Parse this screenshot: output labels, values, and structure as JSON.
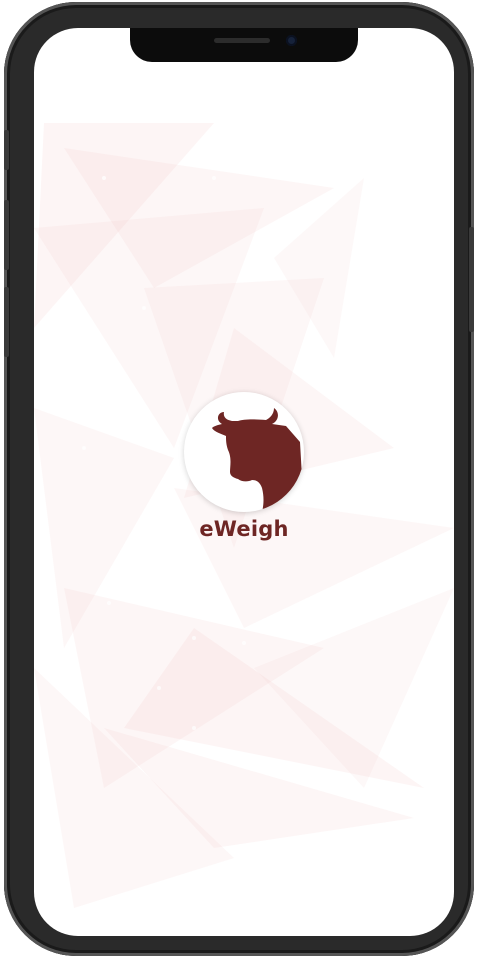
{
  "app": {
    "name": "eWeigh"
  },
  "logo": {
    "icon": "cow-head-icon",
    "brand_color": "#6e2624"
  },
  "background": {
    "tint_color": "#f6d9d9"
  }
}
